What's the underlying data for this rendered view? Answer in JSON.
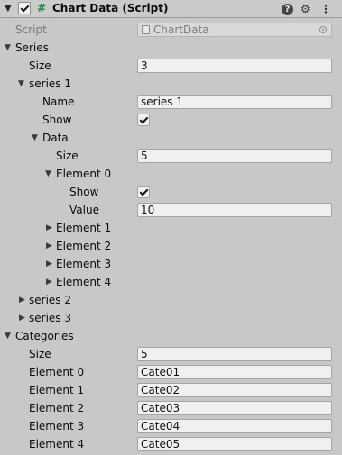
{
  "header": {
    "title": "Chart Data (Script)",
    "script_icon": "#",
    "help_icon": "?",
    "preset_icon": "⚙",
    "menu_icon": "⋮"
  },
  "script_row": {
    "label": "Script",
    "value": "ChartData"
  },
  "series": {
    "label": "Series",
    "size_label": "Size",
    "size_value": "3",
    "series1": {
      "label": "series 1",
      "name_label": "Name",
      "name_value": "series 1",
      "show_label": "Show",
      "data": {
        "label": "Data",
        "size_label": "Size",
        "size_value": "5",
        "element0": {
          "label": "Element 0",
          "show_label": "Show",
          "value_label": "Value",
          "value": "10"
        },
        "collapsed_elements": [
          "Element 1",
          "Element 2",
          "Element 3",
          "Element 4"
        ]
      }
    },
    "collapsed_series": [
      "series 2",
      "series 3"
    ]
  },
  "categories": {
    "label": "Categories",
    "size_label": "Size",
    "size_value": "5",
    "elements": [
      {
        "label": "Element 0",
        "value": "Cate01"
      },
      {
        "label": "Element 1",
        "value": "Cate02"
      },
      {
        "label": "Element 2",
        "value": "Cate03"
      },
      {
        "label": "Element 3",
        "value": "Cate04"
      },
      {
        "label": "Element 4",
        "value": "Cate05"
      }
    ]
  },
  "colors": {
    "background": "#c8c8c8",
    "field": "#f0f0f0",
    "script_icon": "#1e8c42"
  }
}
